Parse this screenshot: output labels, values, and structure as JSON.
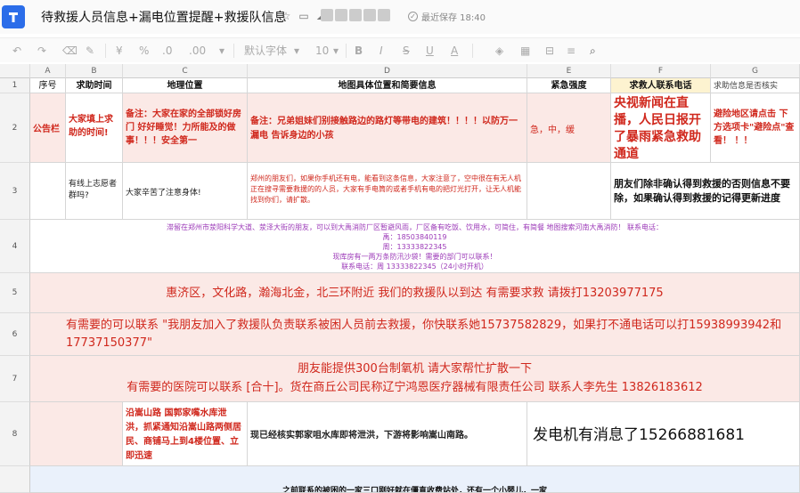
{
  "title_bar": {
    "doc_title": "待救援人员信息+漏电位置提醒+救援队信息",
    "saved_status": "最近保存 18:40"
  },
  "toolbar": {
    "font_name": "默认字体",
    "font_size": "10"
  },
  "columns": [
    "A",
    "B",
    "C",
    "D",
    "E",
    "F",
    "G"
  ],
  "rows": [
    "1",
    "2",
    "3",
    "4",
    "5",
    "6",
    "7",
    "8"
  ],
  "header_row": {
    "a": "序号",
    "b": "求助时间",
    "c": "地理位置",
    "d": "地图具体位置和简要信息",
    "e": "紧急强度",
    "f": "求救人联系电话",
    "g": "求助信息是否核实"
  },
  "row2": {
    "a": "公告栏",
    "b": "大家填上求助的时间!",
    "c": "备注：大家在家的全部锁好房门 好好睡觉！力所能及的做事！！！安全第一",
    "d": "备注：兄弟姐妹们别接触路边的路灯等带电的建筑！！！！以防万一漏电 告诉身边的小孩",
    "e": "急，中，缓",
    "f": "央视新闻在直播，人民日报开了暴雨紧急救助通道",
    "g": "避险地区请点击 下方选项卡\"避险点\"查看！ ！！"
  },
  "row3": {
    "b": "有线上志愿者群吗?",
    "c": "大家辛苦了注意身体!",
    "d": "郑州的朋友们，如果你手机还有电，能看到这条信息，大家注意了，空中很在有无人机正在搜寻需要救援的的人员，大家有手电筒的或者手机有电的把灯光打开，让无人机能找到你们，请扩散。",
    "f": "朋友们除非确认得到救援的否则信息不要除，如果确认得到救援的记得更新进度"
  },
  "row4": {
    "line1": "滞留在郑州市荥阳科学大道、荥泽大街的朋友，可以到大禹消防厂区暂避风雨，厂区备有吃饭、饮用水，可简住，有简餐 地图搜索河南大禹消防！ 联系电话：",
    "line2": "禹：18503840119",
    "line3": "周：13333822345",
    "line4": "现库房有一两万条防汛沙袋！需要的部门可以联系！",
    "line5": "联系电话：周 13333822345（24小时开机）"
  },
  "row5": {
    "text": "惠济区，文化路，瀚海北金，北三环附近 我们的救援队以到达 有需要求救 请拨打13203977175"
  },
  "row6": {
    "text": "有需要的可以联系 \"我朋友加入了救援队负责联系被困人员前去救援，你快联系她15737582829，如果打不通电话可以打15938993942和17737150377\""
  },
  "row7": {
    "line1": "朋友能提供300台制氧机 请大家帮忙扩散一下",
    "line2": "有需要的医院可以联系 [合十]。货在商丘公司民称辽宁鸿恩医疗器械有限责任公司 联系人李先生 13826183612"
  },
  "row8": {
    "c": "沿嵩山路 国郭家嘴水库泄洪，抓紧通知沿嵩山路两侧居民、商铺马上到4楼位置、立即迅速",
    "d": "现已经核实郭家咀水库即将泄洪，下游将影响嵩山南路。",
    "e": "发电机有消息了15266881681"
  },
  "row9": {
    "text": "之前联系的被困的一家三口刚好就在僵直收费站处，还有一个小婴儿，一家"
  }
}
